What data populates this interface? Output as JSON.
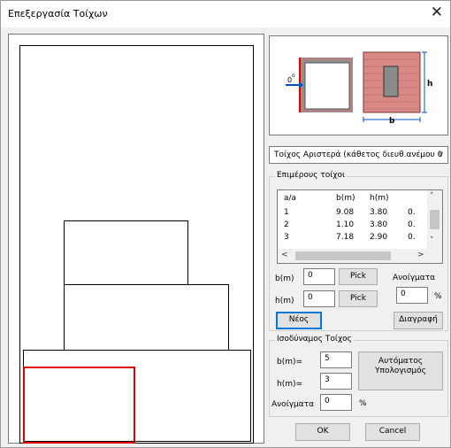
{
  "window": {
    "title": "Επεξεργασία Τοίχων",
    "close_glyph": "✕"
  },
  "preview": {
    "zero_label": "0",
    "degree": "o",
    "h_label": "h",
    "b_label": "b"
  },
  "combo": {
    "selected": "Τοίχος Αριστερά (κάθετος διευθ.ανέμου 0",
    "arrow": "∨"
  },
  "partial_walls": {
    "group_title": "Επιμέρους τοίχοι",
    "columns": [
      "a/a",
      "b(m)",
      "h(m)",
      ""
    ],
    "rows": [
      [
        "1",
        "9.08",
        "3.80",
        "0."
      ],
      [
        "2",
        "1.10",
        "3.80",
        "0."
      ],
      [
        "3",
        "7.18",
        "2.90",
        "0."
      ]
    ],
    "b_label": "b(m)",
    "b_value": "0",
    "h_label": "h(m)",
    "h_value": "0",
    "pick_label": "Pick",
    "openings_label": "Ανοίγματα",
    "openings_value": "0",
    "percent": "%",
    "new_label": "Νέος",
    "delete_label": "Διαγραφή"
  },
  "equivalent_wall": {
    "group_title": "Ισοδύναμος Τοίχος",
    "b_label": "b(m)=",
    "b_value": "5",
    "h_label": "h(m)=",
    "h_value": "3",
    "openings_label": "Ανοίγματα",
    "openings_value": "0",
    "percent": "%",
    "auto_line1": "Αυτόματος",
    "auto_line2": "Υπολογισμός"
  },
  "footer": {
    "ok_label": "OK",
    "cancel_label": "Cancel"
  },
  "icons": {
    "close": "close-icon",
    "dropdown": "chevron-down-icon",
    "scroll_up": "scroll-up-arrow-icon",
    "scroll_down": "scroll-down-arrow-icon",
    "scroll_left": "scroll-left-arrow-icon",
    "scroll_right": "scroll-right-arrow-icon"
  },
  "colors": {
    "selected_wall": "#e00000",
    "brick": "#d98a86",
    "highlight": "#0078d7"
  }
}
